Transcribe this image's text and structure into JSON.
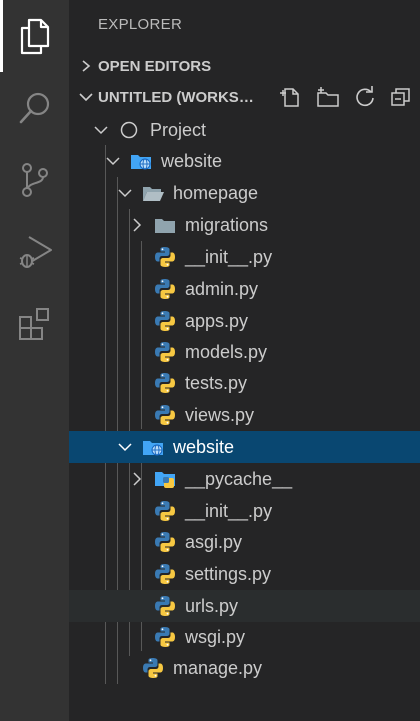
{
  "sidebar": {
    "title": "EXPLORER",
    "open_editors": "OPEN EDITORS",
    "workspace": "UNTITLED (WORKSPACE)"
  },
  "tree": [
    {
      "label": "Project",
      "kind": "root"
    },
    {
      "label": "website",
      "kind": "folder-web"
    },
    {
      "label": "homepage",
      "kind": "folder-open"
    },
    {
      "label": "migrations",
      "kind": "folder"
    },
    {
      "label": "__init__.py",
      "kind": "py"
    },
    {
      "label": "admin.py",
      "kind": "py"
    },
    {
      "label": "apps.py",
      "kind": "py"
    },
    {
      "label": "models.py",
      "kind": "py"
    },
    {
      "label": "tests.py",
      "kind": "py"
    },
    {
      "label": "views.py",
      "kind": "py"
    },
    {
      "label": "website",
      "kind": "folder-web"
    },
    {
      "label": "__pycache__",
      "kind": "folder-py"
    },
    {
      "label": "__init__.py",
      "kind": "py"
    },
    {
      "label": "asgi.py",
      "kind": "py"
    },
    {
      "label": "settings.py",
      "kind": "py"
    },
    {
      "label": "urls.py",
      "kind": "py"
    },
    {
      "label": "wsgi.py",
      "kind": "py"
    },
    {
      "label": "manage.py",
      "kind": "py"
    }
  ],
  "colors": {
    "activity_bar": "#333333",
    "sidebar": "#252526",
    "selection": "#094771",
    "folder": "#90a4ae",
    "web_folder": "#42a5f5"
  }
}
